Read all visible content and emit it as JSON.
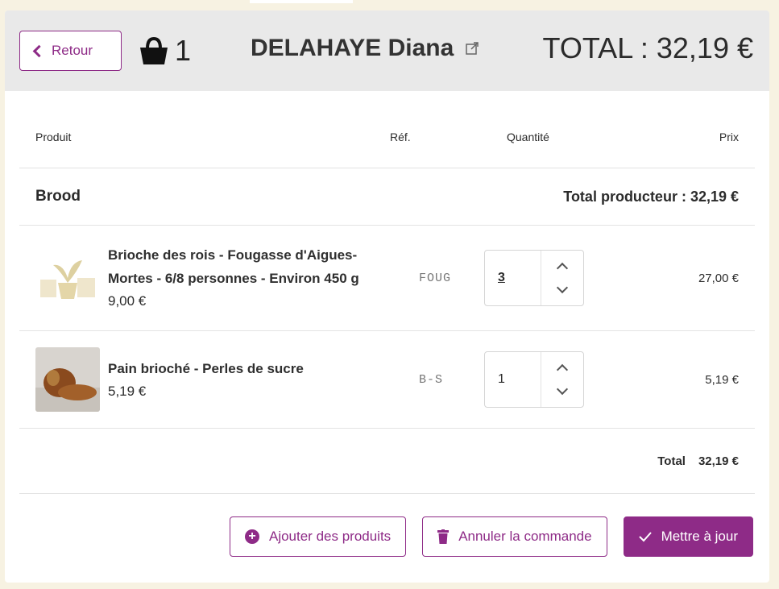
{
  "header": {
    "back_label": "Retour",
    "basket_count": "1",
    "customer_name": "DELAHAYE Diana",
    "total_label": "TOTAL : 32,19 €"
  },
  "table": {
    "col_product": "Produit",
    "col_ref": "Réf.",
    "col_quantity": "Quantité",
    "col_price": "Prix"
  },
  "group": {
    "name": "Brood",
    "total_label": "Total producteur : 32,19 €"
  },
  "items": [
    {
      "name": "Brioche des rois - Fougasse d'Aigues-Mortes - 6/8 personnes - Environ 450 g",
      "unit_price": "9,00 €",
      "ref": "FOUG",
      "quantity": "3",
      "price": "27,00 €",
      "image": "plant-placeholder-icon"
    },
    {
      "name": "Pain brioché - Perles de sucre",
      "unit_price": "5,19 €",
      "ref": "B-S",
      "quantity": "1",
      "price": "5,19 €",
      "image": "brioche-photo"
    }
  ],
  "summary": {
    "total_label": "Total",
    "total_value": "32,19 €"
  },
  "actions": {
    "add_products": "Ajouter des produits",
    "cancel_order": "Annuler la commande",
    "update": "Mettre à jour"
  },
  "colors": {
    "accent": "#8e2b87",
    "header_bg": "#e9e9e9",
    "page_bg": "#f7f2e2"
  }
}
